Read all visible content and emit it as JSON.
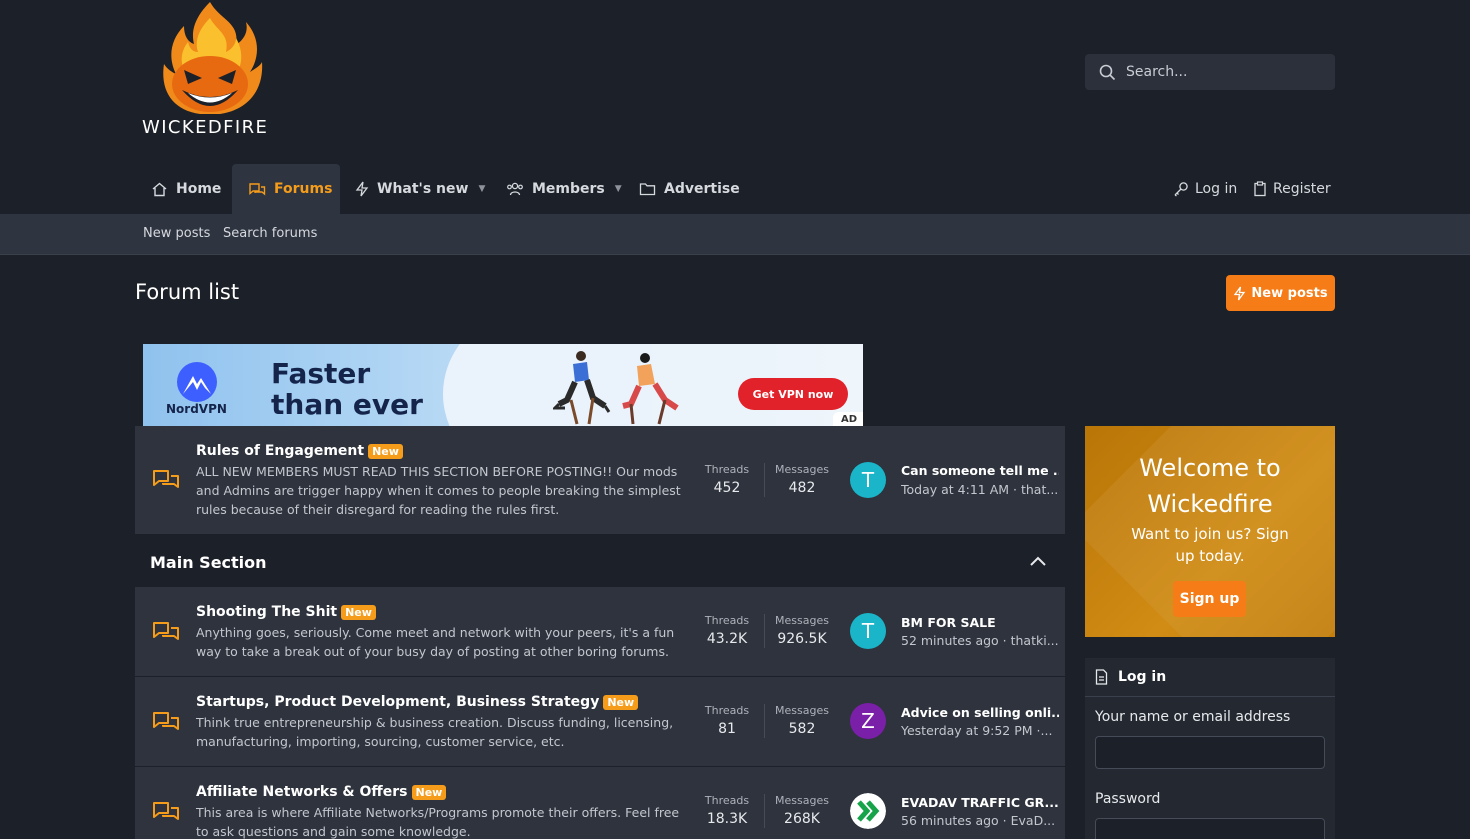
{
  "site": {
    "logo_text": "WICKEDFIRE"
  },
  "search": {
    "placeholder": "Search..."
  },
  "nav": {
    "home": "Home",
    "forums": "Forums",
    "whats_new": "What's new",
    "members": "Members",
    "advertise": "Advertise",
    "login": "Log in",
    "register": "Register"
  },
  "subnav": {
    "new_posts": "New posts",
    "search_forums": "Search forums"
  },
  "page": {
    "title": "Forum list",
    "new_posts_button": "New posts"
  },
  "ad": {
    "brand": "NordVPN",
    "headline_line1": "Faster",
    "headline_line2": "than ever",
    "cta": "Get VPN now",
    "tag": "AD"
  },
  "forums": {
    "rules": {
      "title": "Rules of Engagement",
      "badge": "New",
      "desc": "ALL NEW MEMBERS MUST READ THIS SECTION BEFORE POSTING!! Our mods and Admins are trigger happy when it comes to people breaking the simplest rules because of their disregard for reading the rules first.",
      "threads_label": "Threads",
      "threads": "452",
      "messages_label": "Messages",
      "messages": "482",
      "avatar_letter": "T",
      "last_title": "Can someone tell me ...",
      "last_meta": "Today at 4:11 AM · that..."
    },
    "section_title": "Main Section",
    "items": [
      {
        "title": "Shooting The Shit",
        "badge": "New",
        "desc": "Anything goes, seriously. Come meet and network with your peers, it's a fun way to take a break out of your busy day of posting at other boring forums.",
        "threads_label": "Threads",
        "threads": "43.2K",
        "messages_label": "Messages",
        "messages": "926.5K",
        "avatar_letter": "T",
        "last_title": "BM FOR SALE",
        "last_meta": "52 minutes ago · thatki..."
      },
      {
        "title": "Startups, Product Development, Business Strategy",
        "badge": "New",
        "desc": "Think true entrepreneurship & business creation. Discuss funding, licensing, manufacturing, importing, sourcing, customer service, etc.",
        "threads_label": "Threads",
        "threads": "81",
        "messages_label": "Messages",
        "messages": "582",
        "avatar_letter": "Z",
        "last_title": "Advice on selling onli...",
        "last_meta": "Yesterday at 9:52 PM ·..."
      },
      {
        "title": "Affiliate Networks & Offers",
        "badge": "New",
        "desc": "This area is where Affiliate Networks/Programs promote their offers. Feel free to ask questions and gain some knowledge.",
        "threads_label": "Threads",
        "threads": "18.3K",
        "messages_label": "Messages",
        "messages": "268K",
        "avatar_letter": "",
        "last_title": "EVADAV TRAFFIC GR...",
        "last_meta": "56 minutes ago · EvaD..."
      }
    ]
  },
  "welcome": {
    "title": "Welcome to Wickedfire",
    "subtitle": "Want to join us? Sign up today.",
    "signup": "Sign up"
  },
  "login_box": {
    "title": "Log in",
    "name_label": "Your name or email address",
    "password_label": "Password"
  },
  "colors": {
    "accent": "#f59c1a",
    "button": "#f57c16",
    "background": "#1c2028",
    "row": "#2e333d",
    "avatar_teal": "#1ab5c8",
    "avatar_purple": "#7a1fa8"
  }
}
